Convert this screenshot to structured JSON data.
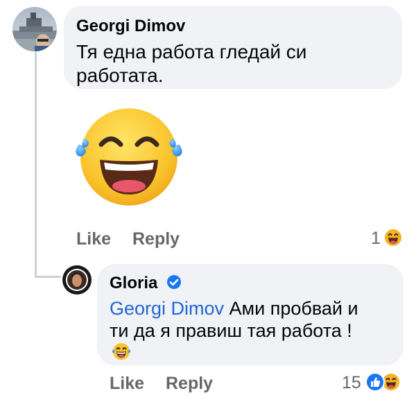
{
  "comment": {
    "author": "Georgi Dimov",
    "text_line1": "Тя една работа гледай си",
    "text_line2": "работата.",
    "sticker": "laughing-tears-emoji",
    "actions": {
      "like": "Like",
      "reply": "Reply"
    },
    "reaction_count": "1",
    "reaction_icons": [
      "haha-icon"
    ]
  },
  "reply": {
    "author": "Gloria",
    "verified": true,
    "mention": "Georgi Dimov",
    "text_line1_rest": " Ами пробвай и",
    "text_line2": "ти да я правиш тая работа !",
    "inline_emoji": "laughing-tears-emoji",
    "actions": {
      "like": "Like",
      "reply": "Reply"
    },
    "reaction_count": "15",
    "reaction_icons": [
      "like-icon",
      "haha-icon"
    ]
  },
  "colors": {
    "bubble": "#f0f2f5",
    "mention": "#2166d4",
    "secondary_text": "#65676b",
    "verified": "#1877f2",
    "like": "#1877f2",
    "haha": "#f7b125"
  }
}
